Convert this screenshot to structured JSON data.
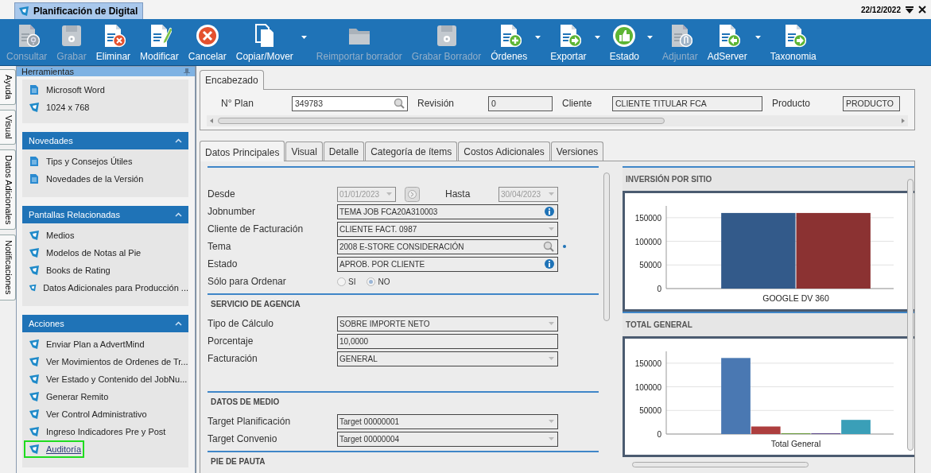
{
  "window": {
    "title": "Planificación de Digital",
    "date": "22/12/2022"
  },
  "toolbar": {
    "buttons": [
      {
        "label": "Consultar",
        "disabled": true,
        "dropdown": false
      },
      {
        "label": "Grabar",
        "disabled": true,
        "dropdown": false
      },
      {
        "label": "Eliminar",
        "disabled": false,
        "dropdown": false
      },
      {
        "label": "Modificar",
        "disabled": false,
        "dropdown": false
      },
      {
        "label": "Cancelar",
        "disabled": false,
        "dropdown": false
      },
      {
        "label": "Copiar/Mover",
        "disabled": false,
        "dropdown": true
      },
      {
        "label": "Reimportar borrador",
        "disabled": true,
        "dropdown": false
      },
      {
        "label": "Grabar Borrador",
        "disabled": true,
        "dropdown": false
      },
      {
        "label": "Órdenes",
        "disabled": false,
        "dropdown": true
      },
      {
        "label": "Exportar",
        "disabled": false,
        "dropdown": true
      },
      {
        "label": "Estado",
        "disabled": false,
        "dropdown": true
      },
      {
        "label": "Adjuntar",
        "disabled": true,
        "dropdown": false
      },
      {
        "label": "AdServer",
        "disabled": false,
        "dropdown": true
      },
      {
        "label": "Taxonomia",
        "disabled": false,
        "dropdown": false
      }
    ]
  },
  "side_tabs": [
    "Ayuda",
    "Visual",
    "Datos Adicionales",
    "Notificaciones"
  ],
  "tools_panel": {
    "title": "Herramientas",
    "items": [
      {
        "label": "Microsoft Word",
        "kind": "document"
      },
      {
        "label": "1024 x 768",
        "kind": "screen"
      }
    ],
    "groups": [
      {
        "title": "Novedades",
        "expanded": true,
        "items": [
          {
            "label": "Tips y Consejos Útiles",
            "kind": "document",
            "highlighted": false
          },
          {
            "label": "Novedades de la Versión",
            "kind": "document",
            "highlighted": false
          }
        ]
      },
      {
        "title": "Pantallas Relacionadas",
        "expanded": true,
        "items": [
          {
            "label": "Medios",
            "kind": "screen",
            "highlighted": false
          },
          {
            "label": "Modelos de Notas al Pie",
            "kind": "screen",
            "highlighted": false
          },
          {
            "label": "Books de Rating",
            "kind": "screen",
            "highlighted": false
          },
          {
            "label": "Datos Adicionales para Producción ...",
            "kind": "screen",
            "highlighted": false
          }
        ]
      },
      {
        "title": "Acciones",
        "expanded": true,
        "items": [
          {
            "label": "Enviar Plan a AdvertMind",
            "kind": "screen",
            "highlighted": false
          },
          {
            "label": "Ver Movimientos de Ordenes de Tr...",
            "kind": "screen",
            "highlighted": false
          },
          {
            "label": "Ver Estado y Contenido del JobNu...",
            "kind": "screen",
            "highlighted": false
          },
          {
            "label": "Generar Remito",
            "kind": "screen",
            "highlighted": false
          },
          {
            "label": "Ver Control Administrativo",
            "kind": "screen",
            "highlighted": false
          },
          {
            "label": "Ingreso Indicadores Pre y Post",
            "kind": "screen",
            "highlighted": false
          },
          {
            "label": "Auditoría",
            "kind": "screen",
            "highlighted": true
          }
        ]
      }
    ]
  },
  "header": {
    "tab": "Encabezado",
    "fields": [
      {
        "label": "N° Plan",
        "value": "349783",
        "kind": "search"
      },
      {
        "label": "Revisión",
        "value": "0",
        "kind": "text"
      },
      {
        "label": "Cliente",
        "value": "CLIENTE TITULAR FCA",
        "kind": "text"
      },
      {
        "label": "Producto",
        "value": "PRODUCTO",
        "kind": "text"
      }
    ]
  },
  "tabs": [
    {
      "label": "Datos Principales",
      "selected": true
    },
    {
      "label": "Visual",
      "selected": false
    },
    {
      "label": "Detalle",
      "selected": false
    },
    {
      "label": "Categoría de ítems",
      "selected": false
    },
    {
      "label": "Costos Adicionales",
      "selected": false
    },
    {
      "label": "Versiones",
      "selected": false
    }
  ],
  "form": {
    "sections": [
      {
        "rows": [
          {
            "kind": "date_range",
            "label": "Desde",
            "value": "01/01/2023",
            "to_label": "Hasta",
            "to_value": "30/04/2023",
            "disabled": true,
            "required": false
          },
          {
            "kind": "info",
            "label": "Jobnumber",
            "value": "TEMA JOB FCA20A310003",
            "required": false
          },
          {
            "kind": "dropdown",
            "label": "Cliente de Facturación",
            "value": "CLIENTE FACT. 0987",
            "required": false
          },
          {
            "kind": "search",
            "label": "Tema",
            "value": "2008 E-STORE CONSIDERACIÓN",
            "required": true
          },
          {
            "kind": "info",
            "label": "Estado",
            "value": "APROB. POR CLIENTE",
            "required": false
          },
          {
            "kind": "radio",
            "label": "Sólo para Ordenar",
            "disabled": true,
            "required": false,
            "options": [
              {
                "label": "SI",
                "selected": false
              },
              {
                "label": "NO",
                "selected": true
              }
            ]
          }
        ]
      },
      {
        "title": "SERVICIO DE AGENCIA",
        "rows": [
          {
            "kind": "dropdown",
            "label": "Tipo de Cálculo",
            "value": "SOBRE IMPORTE NETO",
            "required": false
          },
          {
            "kind": "text",
            "label": "Porcentaje",
            "value": "10,0000",
            "required": false
          },
          {
            "kind": "dropdown",
            "label": "Facturación",
            "value": "GENERAL",
            "required": false
          }
        ]
      },
      {
        "title": "DATOS DE MEDIO",
        "rows": [
          {
            "kind": "dropdown",
            "label": "Target Planificación",
            "value": "Target 00000001",
            "required": false
          },
          {
            "kind": "dropdown",
            "label": "Target Convenio",
            "value": "Target 00000004",
            "required": false
          }
        ]
      },
      {
        "title": "PIE DE PAUTA"
      }
    ]
  },
  "charts": [
    {
      "title": "INVERSIÓN POR SITIO",
      "chart_data": {
        "type": "bar",
        "categories": [
          "GOOGLE DV 360"
        ],
        "series": [
          {
            "color": "#335a8a",
            "values": [
              160000
            ]
          },
          {
            "color": "#8b3232",
            "values": [
              160000
            ]
          }
        ],
        "ylim": [
          0,
          175000
        ],
        "yticks": [
          0,
          50000,
          100000,
          150000
        ],
        "grid": true
      }
    },
    {
      "title": "TOTAL GENERAL",
      "chart_data": {
        "type": "bar",
        "categories": [
          "Total General"
        ],
        "series": [
          {
            "color": "#4a78b2",
            "values": [
              161000
            ]
          },
          {
            "color": "#ad3e3e",
            "values": [
              16000
            ]
          },
          {
            "color": "#6a9a3a",
            "values": [
              0
            ]
          },
          {
            "color": "#5e4a8a",
            "values": [
              0
            ]
          },
          {
            "color": "#3a9fb8",
            "values": [
              30000
            ]
          }
        ],
        "ylim": [
          0,
          175000
        ],
        "yticks": [
          0,
          50000,
          100000,
          150000
        ],
        "grid": true
      }
    }
  ]
}
